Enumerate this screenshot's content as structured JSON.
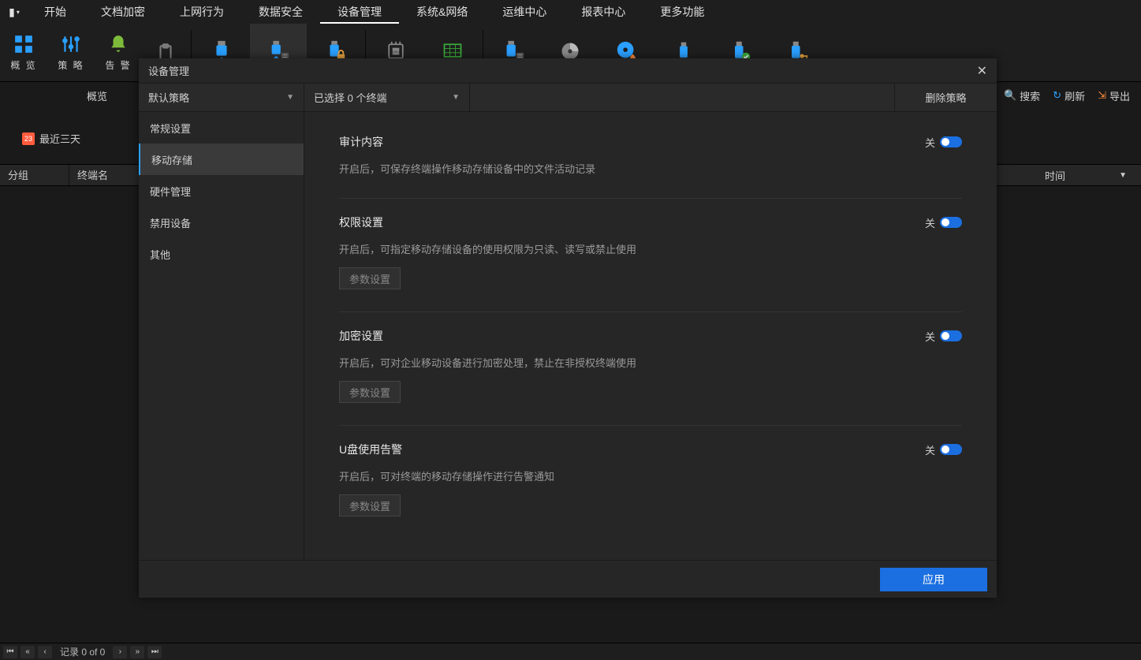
{
  "top_tabs": {
    "items": [
      "开始",
      "文档加密",
      "上网行为",
      "数据安全",
      "设备管理",
      "系统&网络",
      "运维中心",
      "报表中心",
      "更多功能"
    ],
    "active_index": 4
  },
  "ribbon": {
    "labeled": [
      {
        "label": "概 览"
      },
      {
        "label": "策 略"
      },
      {
        "label": "告 警"
      }
    ]
  },
  "bg": {
    "center_label": "概览",
    "date_filter": "最近三天",
    "date_num": "23",
    "actions": {
      "search": "搜索",
      "refresh": "刷新",
      "export": "导出"
    },
    "table": {
      "group": "分组",
      "terminal": "终端名",
      "time": "时间"
    }
  },
  "modal": {
    "title": "设备管理",
    "dd_policy": "默认策略",
    "dd_terminal": "已选择 0 个终端",
    "delete": "删除策略",
    "side": [
      "常规设置",
      "移动存储",
      "硬件管理",
      "禁用设备",
      "其他"
    ],
    "side_active": 1,
    "sections": [
      {
        "title": "审计内容",
        "desc": "开启后，可保存终端操作移动存储设备中的文件活动记录",
        "toggle": "关",
        "param": null
      },
      {
        "title": "权限设置",
        "desc": "开启后，可指定移动存储设备的使用权限为只读、读写或禁止使用",
        "toggle": "关",
        "param": "参数设置"
      },
      {
        "title": "加密设置",
        "desc": "开启后，可对企业移动设备进行加密处理，禁止在非授权终端使用",
        "toggle": "关",
        "param": "参数设置"
      },
      {
        "title": "U盘使用告警",
        "desc": "开启后，可对终端的移动存储操作进行告警通知",
        "toggle": "关",
        "param": "参数设置"
      }
    ],
    "apply": "应用"
  },
  "statusbar": {
    "record": "记录 0 of 0"
  }
}
